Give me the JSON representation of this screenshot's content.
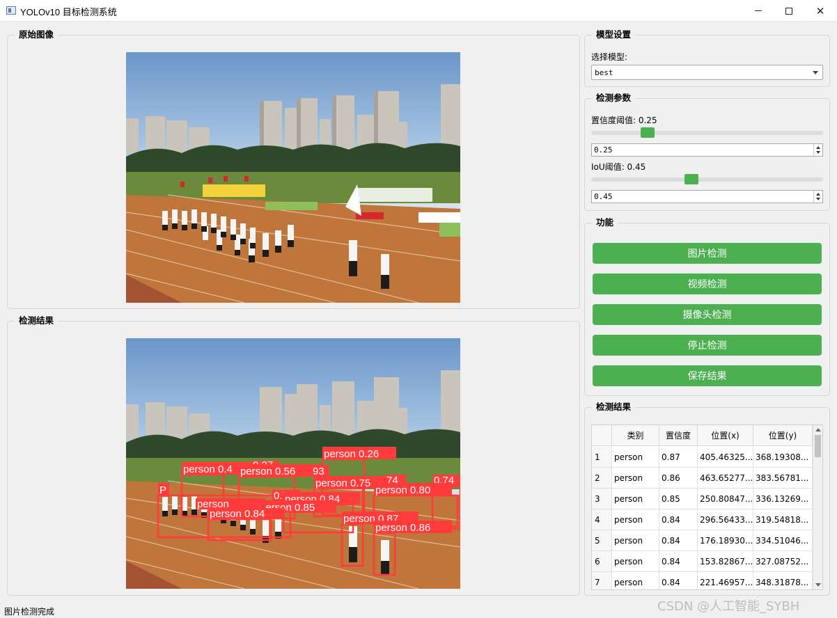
{
  "window": {
    "title": "YOLOv10 目标检测系统",
    "controls": {
      "minimize": "minimize-icon",
      "maximize": "maximize-icon",
      "close": "✕"
    }
  },
  "original_panel": {
    "title": "原始图像"
  },
  "result_panel": {
    "title": "检测结果"
  },
  "model_settings": {
    "title": "模型设置",
    "select_label": "选择模型:",
    "selected_model": "best"
  },
  "detection_params": {
    "title": "检测参数",
    "confidence_label": "置信度阈值: 0.25",
    "confidence_value": "0.25",
    "confidence_slider_level": 0.25,
    "iou_label": "IoU阈值: 0.45",
    "iou_value": "0.45",
    "iou_slider_level": 0.45
  },
  "functions": {
    "title": "功能",
    "buttons": [
      "图片检测",
      "视频检测",
      "摄像头检测",
      "停止检测",
      "保存结果"
    ]
  },
  "results_table": {
    "title": "检测结果",
    "headers": [
      "",
      "类别",
      "置信度",
      "位置(x)",
      "位置(y)"
    ],
    "rows": [
      [
        "1",
        "person",
        "0.87",
        "405.46325...",
        "368.19308..."
      ],
      [
        "2",
        "person",
        "0.86",
        "463.65277...",
        "383.56781..."
      ],
      [
        "3",
        "person",
        "0.85",
        "250.80847...",
        "336.13269..."
      ],
      [
        "4",
        "person",
        "0.84",
        "296.56433...",
        "319.54818..."
      ],
      [
        "5",
        "person",
        "0.84",
        "176.18930...",
        "334.51046..."
      ],
      [
        "6",
        "person",
        "0.84",
        "153.82867...",
        "327.08752..."
      ],
      [
        "7",
        "person",
        "0.84",
        "221.46957...",
        "348.31878..."
      ]
    ]
  },
  "detections_overlay": {
    "labels": [
      "person 0.26",
      "person 0.4",
      "0.27",
      "person 0.56",
      "93",
      "person 0.75",
      "74",
      "0.74",
      "person 0.80",
      "0.75",
      "person 0.84",
      "person 0.85",
      "person 0.84",
      "person 0.87",
      "person 0.86",
      "P",
      "person"
    ]
  },
  "status": {
    "text": "图片检测完成"
  },
  "watermark": "CSDN @人工智能_SYBH",
  "colors": {
    "accent_green": "#4caf50",
    "detection_red": "#ff3b3b"
  }
}
